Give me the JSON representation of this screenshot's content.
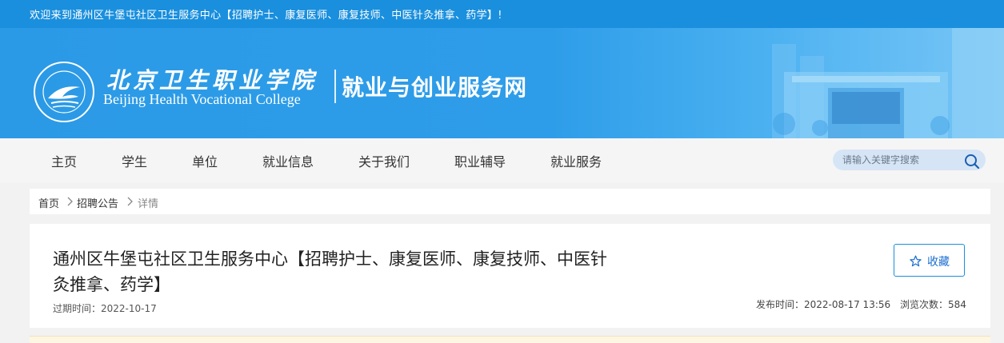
{
  "topbar": {
    "welcome": "欢迎来到通州区牛堡屯社区卫生服务中心【招聘护士、康复医师、康复技师、中医针灸推拿、药学】!"
  },
  "header": {
    "school_cn": "北京卫生职业学院",
    "school_en": "Beijing Health Vocational College",
    "site_name": "就业与创业服务网"
  },
  "nav": {
    "items": [
      {
        "label": "主页"
      },
      {
        "label": "学生"
      },
      {
        "label": "单位"
      },
      {
        "label": "就业信息"
      },
      {
        "label": "关于我们"
      },
      {
        "label": "职业辅导"
      },
      {
        "label": "就业服务"
      }
    ]
  },
  "search": {
    "placeholder": "请输入关键字搜索"
  },
  "breadcrumb": {
    "items": [
      "首页",
      "招聘公告",
      "详情"
    ]
  },
  "article": {
    "title": "通州区牛堡屯社区卫生服务中心【招聘护士、康复医师、康复技师、中医针灸推拿、药学】",
    "expire": "过期时间：2022-10-17",
    "favorite_label": "收藏",
    "publish_time": "发布时间：2022-08-17 13:56",
    "view_count": "浏览次数：584"
  },
  "colors": {
    "primary": "#1a8fdd",
    "banner": "#2e9de9",
    "nav_bg": "#f5f5f5",
    "search_bg": "#d6e5f6"
  },
  "icons": {
    "search": "search-icon",
    "favorite": "star-outline-icon",
    "breadcrumb_sep": "chevron-right-icon"
  }
}
